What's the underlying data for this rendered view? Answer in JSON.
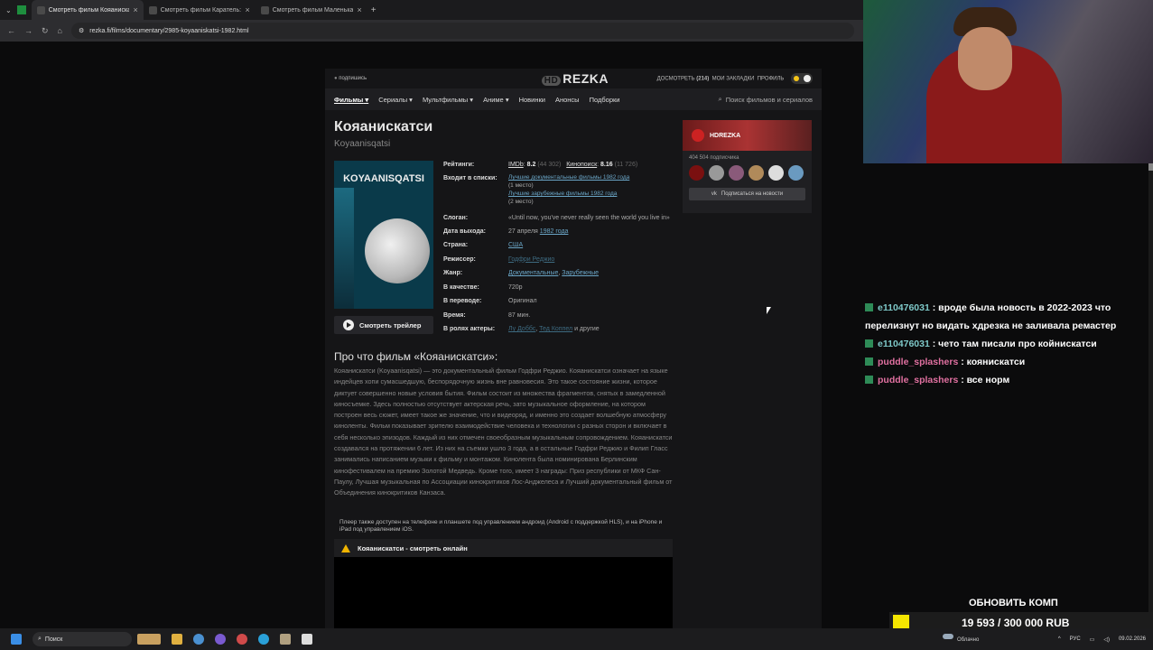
{
  "browser": {
    "tabs": [
      {
        "title": "Смотреть фильм Кояанискатси"
      },
      {
        "title": "Смотреть фильм Каратель: Те"
      },
      {
        "title": "Смотреть фильм Маленькая"
      }
    ],
    "url": "rezka.fi/films/documentary/2985-koyaaniskatsi-1982.html"
  },
  "site": {
    "subscribe": "подпишись",
    "logo_hd": "HD",
    "logo": "REZKA",
    "watch_later": "ДОСМОТРЕТЬ",
    "watch_later_count": "(214)",
    "bookmarks": "МОИ ЗАКЛАДКИ",
    "profile": "ПРОФИЛЬ",
    "menu": [
      "Фильмы",
      "Сериалы",
      "Мультфильмы",
      "Аниме",
      "Новинки",
      "Анонсы",
      "Подборки"
    ],
    "search_placeholder": "Поиск фильмов и сериалов"
  },
  "movie": {
    "title": "Кояанискатси",
    "original": "Koyaanisqatsi",
    "poster_title": "KOYAANISQATSI",
    "trailer": "Смотреть трейлер",
    "ratings_label": "Рейтинги:",
    "imdb": "IMDb",
    "imdb_val": "8.2",
    "imdb_cnt": "(44 302)",
    "kp": "Кинопоиск",
    "kp_val": "8.16",
    "kp_cnt": "(11 726)",
    "lists_label": "Входит в списки:",
    "list1": "Лучшие документальные фильмы 1982 года",
    "list1_pos": "(1 место)",
    "list2": "Лучшие зарубежные фильмы 1982 года",
    "list2_pos": "(2 место)",
    "slogan_label": "Слоган:",
    "slogan": "«Until now, you've never really seen the world you live in»",
    "date_label": "Дата выхода:",
    "date": "27 апреля",
    "date_year": "1982 года",
    "country_label": "Страна:",
    "country": "США",
    "director_label": "Режиссер:",
    "director": "Годфри Реджио",
    "genre_label": "Жанр:",
    "genre1": "Документальные",
    "genre2": "Зарубежные",
    "quality_label": "В качестве:",
    "quality": "720p",
    "translation_label": "В переводе:",
    "translation": "Оригинал",
    "time_label": "Время:",
    "time": "87 мин.",
    "actors_label": "В ролях актеры:",
    "actor1": "Лу Доббс",
    "actor2": "Тед Коппел",
    "actors_more": "и другие",
    "about_title": "Про что фильм «Кояанискатси»:",
    "about": "Кояанискатси (Koyaanisqatsi) — это документальный фильм Годфри Реджио. Кояанискатси означает на языке индейцев хопи сумасшедшую, беспорядочную жизнь вне равновесия. Это такое состояние жизни, которое диктует совершенно новые условия бытия. Фильм состоит из множества фрагментов, снятых в замедленной киносъемке. Здесь полностью отсутствует актерская речь, зато музыкальное оформление, на котором построен весь сюжет, имеет такое же значение, что и видеоряд, и именно это создает волшебную атмосферу киноленты. Фильм показывает зрителю взаимодействие человека и технологии с разных сторон и включает в себя несколько эпизодов. Каждый из них отмечен своеобразным музыкальным сопровождением. Кояанискатси создавался на протяжении 6 лет. Из них на съемки ушло 3 года, а в остальные Годфри Реджио и Филип Гласс занимались написанием музыки к фильму и монтажом. Кинолента была номинирована Берлинским кинофестивалем на премию Золотой Медведь. Кроме того, имеет 3 награды: Приз республики от МКФ Сан-Паулу, Лучшая музыкальная по Ассоциации кинокритиков Лос-Анджелеса и Лучший документальный фильм от Объединения кинокритиков Канзаса.",
    "note": "Плеер также доступен на телефоне и планшете под управлением андроид (Android с поддержкой HLS), и на iPhone и iPad под управлением iOS.",
    "watch_online": "Кояанискатси - смотреть онлайн"
  },
  "widget": {
    "name": "HDREZKA",
    "subs": "404 504 подписчика",
    "vk": "Подписаться на новости"
  },
  "chat": [
    {
      "user": "e110476031",
      "text": ": вроде была новость в 2022-2023 что перелизнут но видать хдрезка не заливала ремастер"
    },
    {
      "user": "e110476031",
      "text": ": чето там писали про койнискатси"
    },
    {
      "user": "puddle_splashers",
      "text": ": коянискатси"
    },
    {
      "user": "puddle_splashers",
      "text": ": все норм"
    }
  ],
  "goal": {
    "title": "ОБНОВИТЬ КОМП",
    "amount": "19 593 / 300 000 RUB"
  },
  "taskbar": {
    "search": "Поиск",
    "weather": "Облачно",
    "lang": "РУС",
    "date": "09.02.2026"
  }
}
